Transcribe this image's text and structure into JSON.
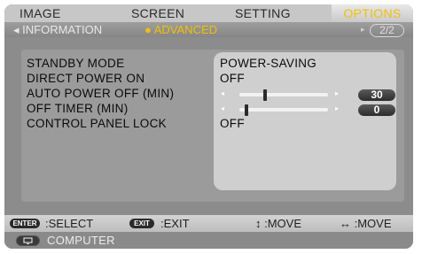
{
  "tabs": [
    "IMAGE",
    "SCREEN",
    "SETTING",
    "OPTIONS"
  ],
  "active_tab": "OPTIONS",
  "subnav": {
    "info": "◂ INFORMATION",
    "advanced": "● ADVANCED",
    "next_arrow": "▸",
    "page": "2/2"
  },
  "settings": [
    {
      "label": "STANDBY MODE",
      "value": "POWER-SAVING"
    },
    {
      "label": "DIRECT POWER ON",
      "value": "OFF"
    },
    {
      "label": "AUTO POWER OFF (MIN)",
      "value": "30",
      "slider_fraction": 0.25
    },
    {
      "label": "OFF TIMER (MIN)",
      "value": "0",
      "slider_fraction": 0.0
    },
    {
      "label": "CONTROL PANEL LOCK",
      "value": "OFF"
    }
  ],
  "slider_arrows": {
    "left": "◂",
    "right": "▸"
  },
  "hints": {
    "enter_key": "ENTER",
    "select": ":SELECT",
    "exit_key": "EXIT",
    "exit": ":EXIT",
    "move_vertical": "↕ :MOVE",
    "move_horizontal": "↔ :MOVE"
  },
  "source": {
    "icon": "monitor-icon",
    "label": "COMPUTER"
  },
  "colors": {
    "accent": "#f2c000",
    "background": "#8d8c8c"
  }
}
